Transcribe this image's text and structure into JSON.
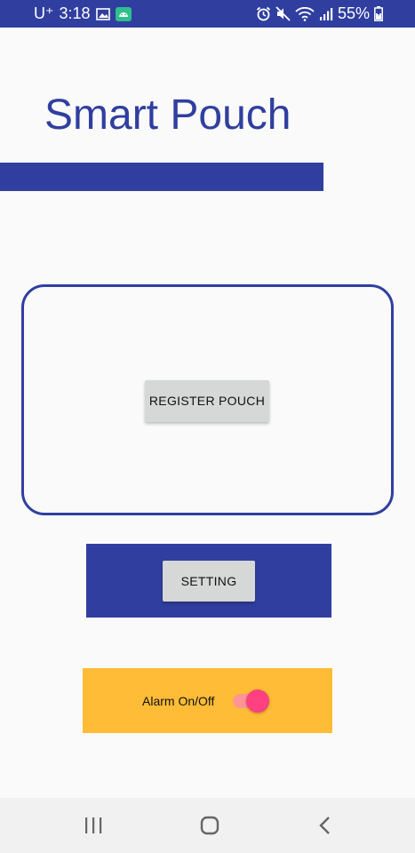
{
  "status_bar": {
    "carrier": "U⁺",
    "time": "3:18",
    "battery_percent": "55%",
    "icons_left": [
      "image-icon",
      "android-icon"
    ],
    "icons_right": [
      "alarm-icon",
      "mute-icon",
      "wifi-icon",
      "signal-icon",
      "battery-icon"
    ]
  },
  "app": {
    "title": "Smart Pouch"
  },
  "register": {
    "button_label": "REGISTER POUCH"
  },
  "setting": {
    "button_label": "SETTING"
  },
  "alarm": {
    "label": "Alarm On/Off",
    "enabled": true
  },
  "nav": {
    "items": [
      "recent-apps-icon",
      "home-icon",
      "back-icon"
    ]
  },
  "colors": {
    "primary": "#303f9f",
    "accent": "#ff4081",
    "alarm_bg": "#ffbc36",
    "button_gray": "#d6d7d7"
  }
}
